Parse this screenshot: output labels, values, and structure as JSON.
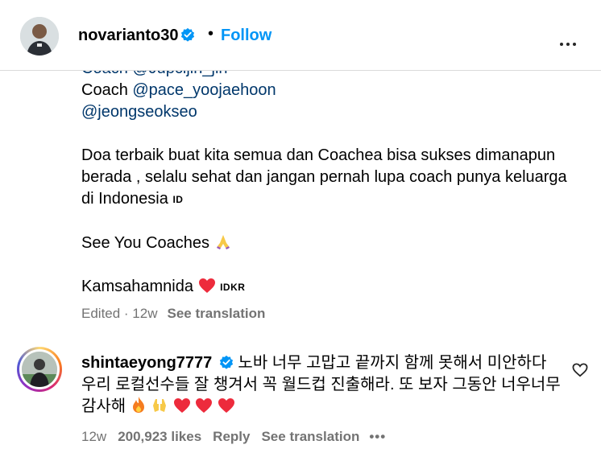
{
  "post": {
    "username": "novarianto30",
    "separator": "•",
    "follow_label": "Follow",
    "more_icon": "more-horizontal-icon"
  },
  "caption": {
    "line_cut": "Coach @Jupcijin_jin",
    "line1_prefix": "Coach ",
    "mention1": "@pace_yoojaehoon",
    "mention2": "@jeongseokseo",
    "paragraph": "Doa terbaik buat kita semua dan Coachea bisa sukses dimanapun berada , selalu sehat dan jangan pernah lupa coach punya keluarga di Indonesia",
    "flag_id": "ID",
    "see_you": "See You Coaches",
    "kamsa": "Kamsahamnida",
    "flag_idkr": "IDKR"
  },
  "meta": {
    "edited": "Edited · 12w",
    "see_translation": "See translation"
  },
  "comment": {
    "username": "shintaeyong7777",
    "text": "노바 너무 고맙고 끝까지 함께 못해서 미안하다 우리 로컬선수들 잘 챙겨서 꼭 월드컵 진출해라. 또 보자 그동안 너우너무 감사해",
    "age": "12w",
    "likes": "200,923 likes",
    "reply": "Reply",
    "see_translation": "See translation",
    "more": "•••"
  },
  "colors": {
    "link": "#0095f6",
    "mention": "#00376b",
    "muted": "#737373",
    "heart": "#ed2b3c"
  }
}
